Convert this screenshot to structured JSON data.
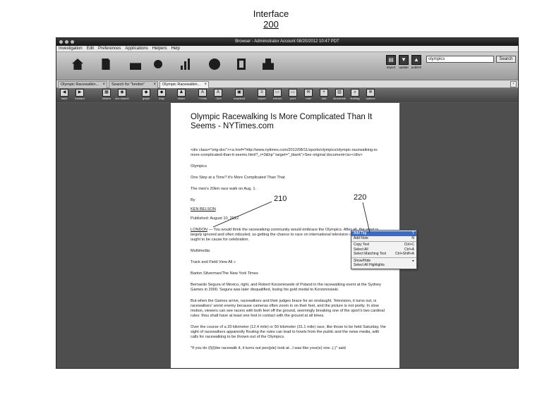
{
  "figure": {
    "caption": "Interface",
    "number": "200"
  },
  "window": {
    "title": "Browser - Administrator Account 08/20/2012 10:47 PDT",
    "menu": [
      "Investigation",
      "Edit",
      "Preferences",
      "Applications",
      "Helpers",
      "Help"
    ]
  },
  "nav": {
    "actions": [
      {
        "icon": "import-icon",
        "label": "import",
        "glyph": "▤"
      },
      {
        "icon": "update-icon",
        "label": "update",
        "glyph": "▼"
      },
      {
        "icon": "publish-icon",
        "label": "publish",
        "glyph": "▲"
      }
    ],
    "search": {
      "value": "olympics",
      "button": "Search"
    }
  },
  "tabs": [
    {
      "label": "Olympic Racewalkin..."
    },
    {
      "label": "Search for \"london\""
    },
    {
      "label": "Olympic Racewalkin..."
    }
  ],
  "toolbar": [
    {
      "label": "back",
      "icon": "back-icon",
      "glyph": "◀"
    },
    {
      "label": "forward",
      "icon": "forward-icon",
      "glyph": "▶"
    },
    {
      "label": "folders",
      "icon": "folders-icon",
      "glyph": "▦"
    },
    {
      "label": "doc search",
      "icon": "doc-search-icon",
      "glyph": "◉"
    },
    {
      "label": "graph",
      "icon": "graph-icon",
      "glyph": "◆"
    },
    {
      "label": "map",
      "icon": "map-icon",
      "glyph": "◆"
    },
    {
      "label": "share",
      "icon": "share-icon",
      "glyph": "♟"
    },
    {
      "label": "+ fonts",
      "icon": "font-increase-icon",
      "glyph": "A"
    },
    {
      "label": "- font",
      "icon": "font-decrease-icon",
      "glyph": "A"
    },
    {
      "label": "snapshot",
      "icon": "snapshot-icon",
      "glyph": "▣"
    },
    {
      "label": "export",
      "icon": "export-icon",
      "glyph": "≡"
    },
    {
      "label": "extract",
      "icon": "extract-icon",
      "glyph": "▭"
    },
    {
      "label": "print",
      "icon": "print-icon",
      "glyph": "▭"
    },
    {
      "label": "mail",
      "icon": "mail-icon",
      "glyph": "✉"
    },
    {
      "label": "add",
      "icon": "add-icon",
      "glyph": "+"
    },
    {
      "label": "show/hide",
      "icon": "show-hide-icon",
      "glyph": "▥"
    },
    {
      "label": "find/tag",
      "icon": "find-tag-icon",
      "glyph": "⌕"
    },
    {
      "label": "options",
      "icon": "options-icon",
      "glyph": "✲"
    }
  ],
  "document": {
    "title": "Olympic Racewalking Is More Complicated Than It Seems - NYTimes.com",
    "source_html": "<div class=\"orig-doc\"><a href=\"http://www.nytimes.com/2012/08/11/sports/olympics/olympic-racewalking-is-more-complicated-than-it-seems.html?_r=3&hp\" target=\"_blank\">See original document</a></div>",
    "section": "Olympics",
    "headline": "One Step at a Time? It's More Complicated Than That",
    "subhead": "The men's 20km race walk on Aug. 1.",
    "by": "By",
    "author": "KEN BELSON",
    "published": "Published: August 10, 2012",
    "lead_london": "LONDON",
    "lead_rest": " — You would think the racewalking community would embrace the Olympics. After all, the sport is largely ignored and often ridiculed, so getting the chance to race on international television once every four years ought to be cause for celebration.",
    "multimedia": "Multimedia",
    "multimedia_link": "Track and Field View All »",
    "photo_credit": "Barton Silverman/The New York Times",
    "caption": "Bernardo Segura of Mexico, right, and Robert Korzeniowski of Poland in the racewalking event at the Sydney Games in 2000. Segura was later disqualified, losing his gold medal to Korzeniowski.",
    "para1": "But when the Games arrive, racewalkers and their judges brace for an onslaught. Television, it turns out, is racewalkers' worst enemy because cameras often zoom in on their feet, and the picture is not pretty. In slow motion, viewers can see racers with both feet off the ground, seemingly breaking one of the sport's two cardinal rules: thou shalt have at least one foot in contact with the ground at all times.",
    "para2": "Over the course of a 20 kilometer (12.4 mile) or 50 kilometer (31.1 mile) race, like those to be held Saturday, the sight of racewalkers apparently flouting the rules can lead to howls from the public and the news media, with calls for racewalking to be thrown out of the Olympics.",
    "para3": "\"If you do (f)(l)ike racewalk it, it turns out peo(ple) look at...I was like your(e) one..(.)\" said"
  },
  "context_menu": [
    {
      "label": "Add Tag",
      "shortcut": "T",
      "highlighted": true
    },
    {
      "label": "Add Note",
      "shortcut": "N"
    },
    {
      "sep": true
    },
    {
      "label": "Copy Text",
      "shortcut": "Ctrl+C"
    },
    {
      "label": "Select All",
      "shortcut": "Ctrl+A"
    },
    {
      "label": "Select Matching Text",
      "shortcut": "Ctrl+Shift+A"
    },
    {
      "sep": true
    },
    {
      "label": "Show/Hide",
      "shortcut": "▸"
    },
    {
      "label": "Select All Highlights",
      "shortcut": ""
    }
  ],
  "reference_labels": {
    "selection": "210",
    "menu": "220"
  }
}
